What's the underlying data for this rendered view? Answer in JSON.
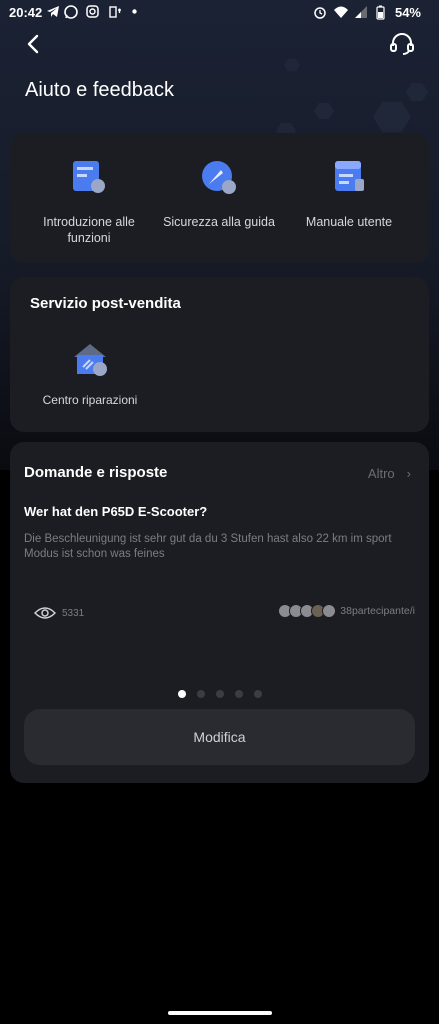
{
  "status_bar": {
    "time": "20:42",
    "battery": "54%",
    "left_icons": [
      "telegram-icon",
      "whatsapp-icon",
      "instagram-icon",
      "usb-icon",
      "dot-icon"
    ],
    "right_icons": [
      "alarm-icon",
      "wifi-icon",
      "signal-icon",
      "battery-icon"
    ]
  },
  "header": {
    "title": "Aiuto e feedback",
    "back_icon": "back-arrow-icon",
    "support_icon": "headset-icon"
  },
  "features": [
    {
      "label": "Introduzione alle funzioni",
      "icon": "intro-functions-icon"
    },
    {
      "label": "Sicurezza alla guida",
      "icon": "safety-compass-icon"
    },
    {
      "label": "Manuale utente",
      "icon": "manual-icon"
    }
  ],
  "after_sales": {
    "title": "Servizio post-vendita",
    "repair_label": "Centro riparazioni",
    "repair_icon": "repair-house-icon"
  },
  "qa": {
    "title": "Domande e risposte",
    "more": "Altro",
    "question_title": "Wer hat den P65D E-Scooter?",
    "question_body": "Die Beschleunigung ist sehr gut da du 3 Stufen hast also 22 km im sport Modus ist schon was feines",
    "views": "5331",
    "participants": "38partecipante/i",
    "page_count": 5,
    "active_page": 1,
    "edit_button": "Modifica"
  },
  "colors": {
    "accent": "#4a7cf0",
    "card_bg": "#1c1d22",
    "muted_text": "#7c7d84"
  }
}
